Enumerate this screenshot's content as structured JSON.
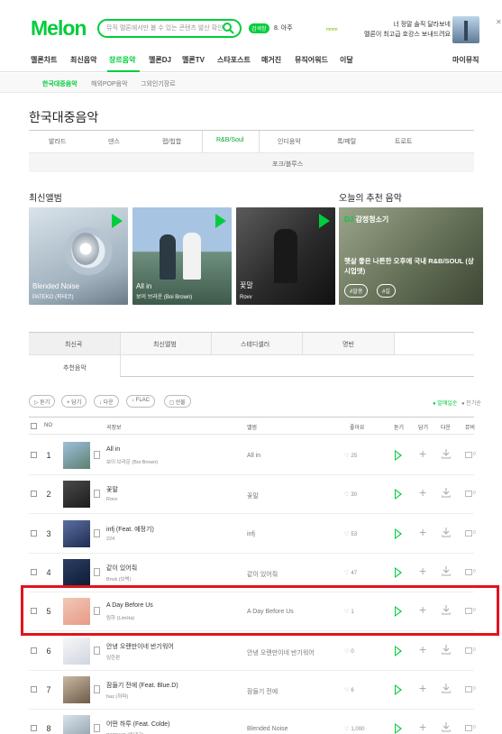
{
  "header": {
    "logo": "Melon",
    "search_placeholder": "뮤직 멜론에서만 볼 수 있는 콘텐츠 발산 확인!",
    "mic_badge": "검색창",
    "rank_keyword": "8. 아주",
    "promo_small": "mmm",
    "ad_line1": "너 정말 솔직 달라보네",
    "ad_line2": "멜론이 최고급 호캉스 보내드려요"
  },
  "gnb": [
    "멜론차트",
    "최신음악",
    "장르음악",
    "멜론DJ",
    "멜론TV",
    "스타포스트",
    "매거진",
    "뮤직어워드",
    "이달",
    "마이뮤직"
  ],
  "gnb_active_index": 2,
  "subnav": [
    "한국대중음악",
    "해외POP음악",
    "그외인기장르"
  ],
  "page_title": "한국대중음악",
  "genres_row1": [
    "발라드",
    "댄스",
    "랩/힙합",
    "R&B/Soul",
    "인디음악",
    "록/메탈",
    "트로트"
  ],
  "genres_row2": [
    "포크/블루스"
  ],
  "sections": {
    "new_albums": "최신앨범",
    "recommend": "오늘의 추천 음악"
  },
  "albums": [
    {
      "title": "Blended Noise",
      "artist": "PATEKO (파테코)"
    },
    {
      "title": "All in",
      "artist": "보이 브라운 (Boi Brown)"
    },
    {
      "title": "꽃말",
      "artist": "Rovv"
    }
  ],
  "dj": {
    "label_prefix": "DJ",
    "label": "감정청소기",
    "text": "햇살 좋은 나른한 오후에 국내 R&B/SOUL (상시업뎃)",
    "tags": [
      "#알쏭",
      "#길"
    ]
  },
  "list_tabs": [
    "최신곡",
    "최신앨범",
    "스테디셀러",
    "명반",
    "추천음악"
  ],
  "actions": [
    "듣기",
    "담기",
    "다운",
    "FLAC",
    "선물"
  ],
  "sort": [
    "발매일순",
    "인기순"
  ],
  "table_headers": {
    "no": "NO",
    "song": "곡정보",
    "album": "앨범",
    "likes": "좋아요",
    "listen": "듣기",
    "add": "담기",
    "download": "다운",
    "mv": "뮤비"
  },
  "songs": [
    {
      "rank": "1",
      "title": "All in",
      "artist": "보이 브라운 (Boi Brown)",
      "album": "All in",
      "likes": "25"
    },
    {
      "rank": "2",
      "title": "꽃말",
      "artist": "Rovv",
      "album": "꽃말",
      "likes": "30"
    },
    {
      "rank": "3",
      "title": "infj (Feat. 예정기)",
      "artist": "224",
      "album": "infj",
      "likes": "53"
    },
    {
      "rank": "4",
      "title": "같이 있어줘",
      "artist": "Bnck (브벅)",
      "album": "같이 있어줘",
      "likes": "47"
    },
    {
      "rank": "5",
      "title": "A Day Before Us",
      "artist": "림하 (LimHa)",
      "album": "A Day Before Us",
      "likes": "1"
    },
    {
      "rank": "6",
      "title": "안녕 오랜만이네 반기워어",
      "artist": "임한판",
      "album": "안녕 오랜만이네 반기워어",
      "likes": "0"
    },
    {
      "rank": "7",
      "title": "잠들기 전에 (Feat. Blue.D)",
      "artist": "haz (하며)",
      "album": "잠들기 전에",
      "likes": "6"
    },
    {
      "rank": "8",
      "title": "어떤 하루 (Feat. Colde)",
      "artist": "PATEKO (파테코)",
      "album": "Blended Noise",
      "likes": "1,000"
    }
  ],
  "mv_label": "0",
  "colors": {
    "accent": "#00cd3c",
    "highlight": "#e0141e"
  }
}
